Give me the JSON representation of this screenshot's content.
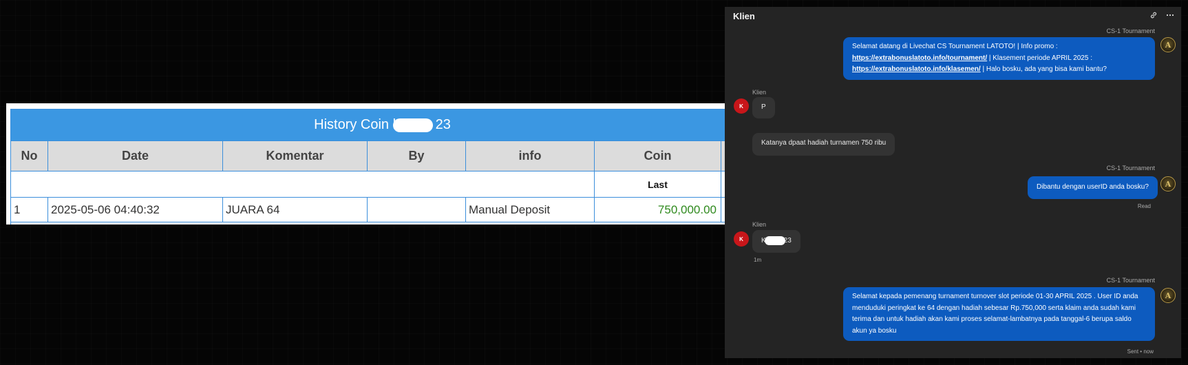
{
  "history_table": {
    "title_prefix": "History Coin k",
    "title_suffix": "23",
    "columns": [
      "No",
      "Date",
      "Komentar",
      "By",
      "info",
      "Coin"
    ],
    "sub_header": "Last",
    "rows": [
      {
        "no": "1",
        "date": "2025-05-06 04:40:32",
        "komentar": "JUARA 64",
        "by": "",
        "info": "Manual Deposit",
        "coin": "750,000.00"
      }
    ]
  },
  "chat": {
    "title": "Klien",
    "header_icons": [
      "link-icon",
      "more-icon"
    ],
    "agent_name": "CS-1 Tournament",
    "client_name": "Klien",
    "client_avatar_letter": "K",
    "agent_avatar_letter": "A",
    "msg1": {
      "line1": "Selamat datang di Livechat CS Tournament LATOTO! | Info promo :",
      "link1": "https://extrabonuslatoto.info/tournament/",
      "after_link1": " | Klasement periode APRIL 2025 :",
      "link2": "https://extrabonuslatoto.info/klasemen/",
      "after_link2": " | Halo bosku, ada yang bisa kami bantu?"
    },
    "msg2": "P",
    "msg3": "Katanya dpaat hadiah turnamen 750 ribu",
    "msg4": "Dibantu dengan userID anda bosku?",
    "msg4_status": "Read",
    "msg5_prefix": "K",
    "msg5_suffix": "23",
    "msg5_time": "1m",
    "msg6": "Selamat kepada pemenang turnament turnover slot periode 01-30 APRIL 2025 . User ID anda menduduki peringkat ke 64 dengan hadiah sebesar Rp.750,000 serta klaim anda sudah kami terima dan untuk hadiah akan kami proses selamat-lambatnya pada tanggal-6 berupa saldo akun ya bosku",
    "msg6_status": "Sent • now",
    "colors": {
      "agent_bubble": "#0d5bbf",
      "client_bubble": "#333333",
      "panel": "#242424",
      "coin_green": "#2f8a1e",
      "table_header": "#3b97e2"
    }
  }
}
